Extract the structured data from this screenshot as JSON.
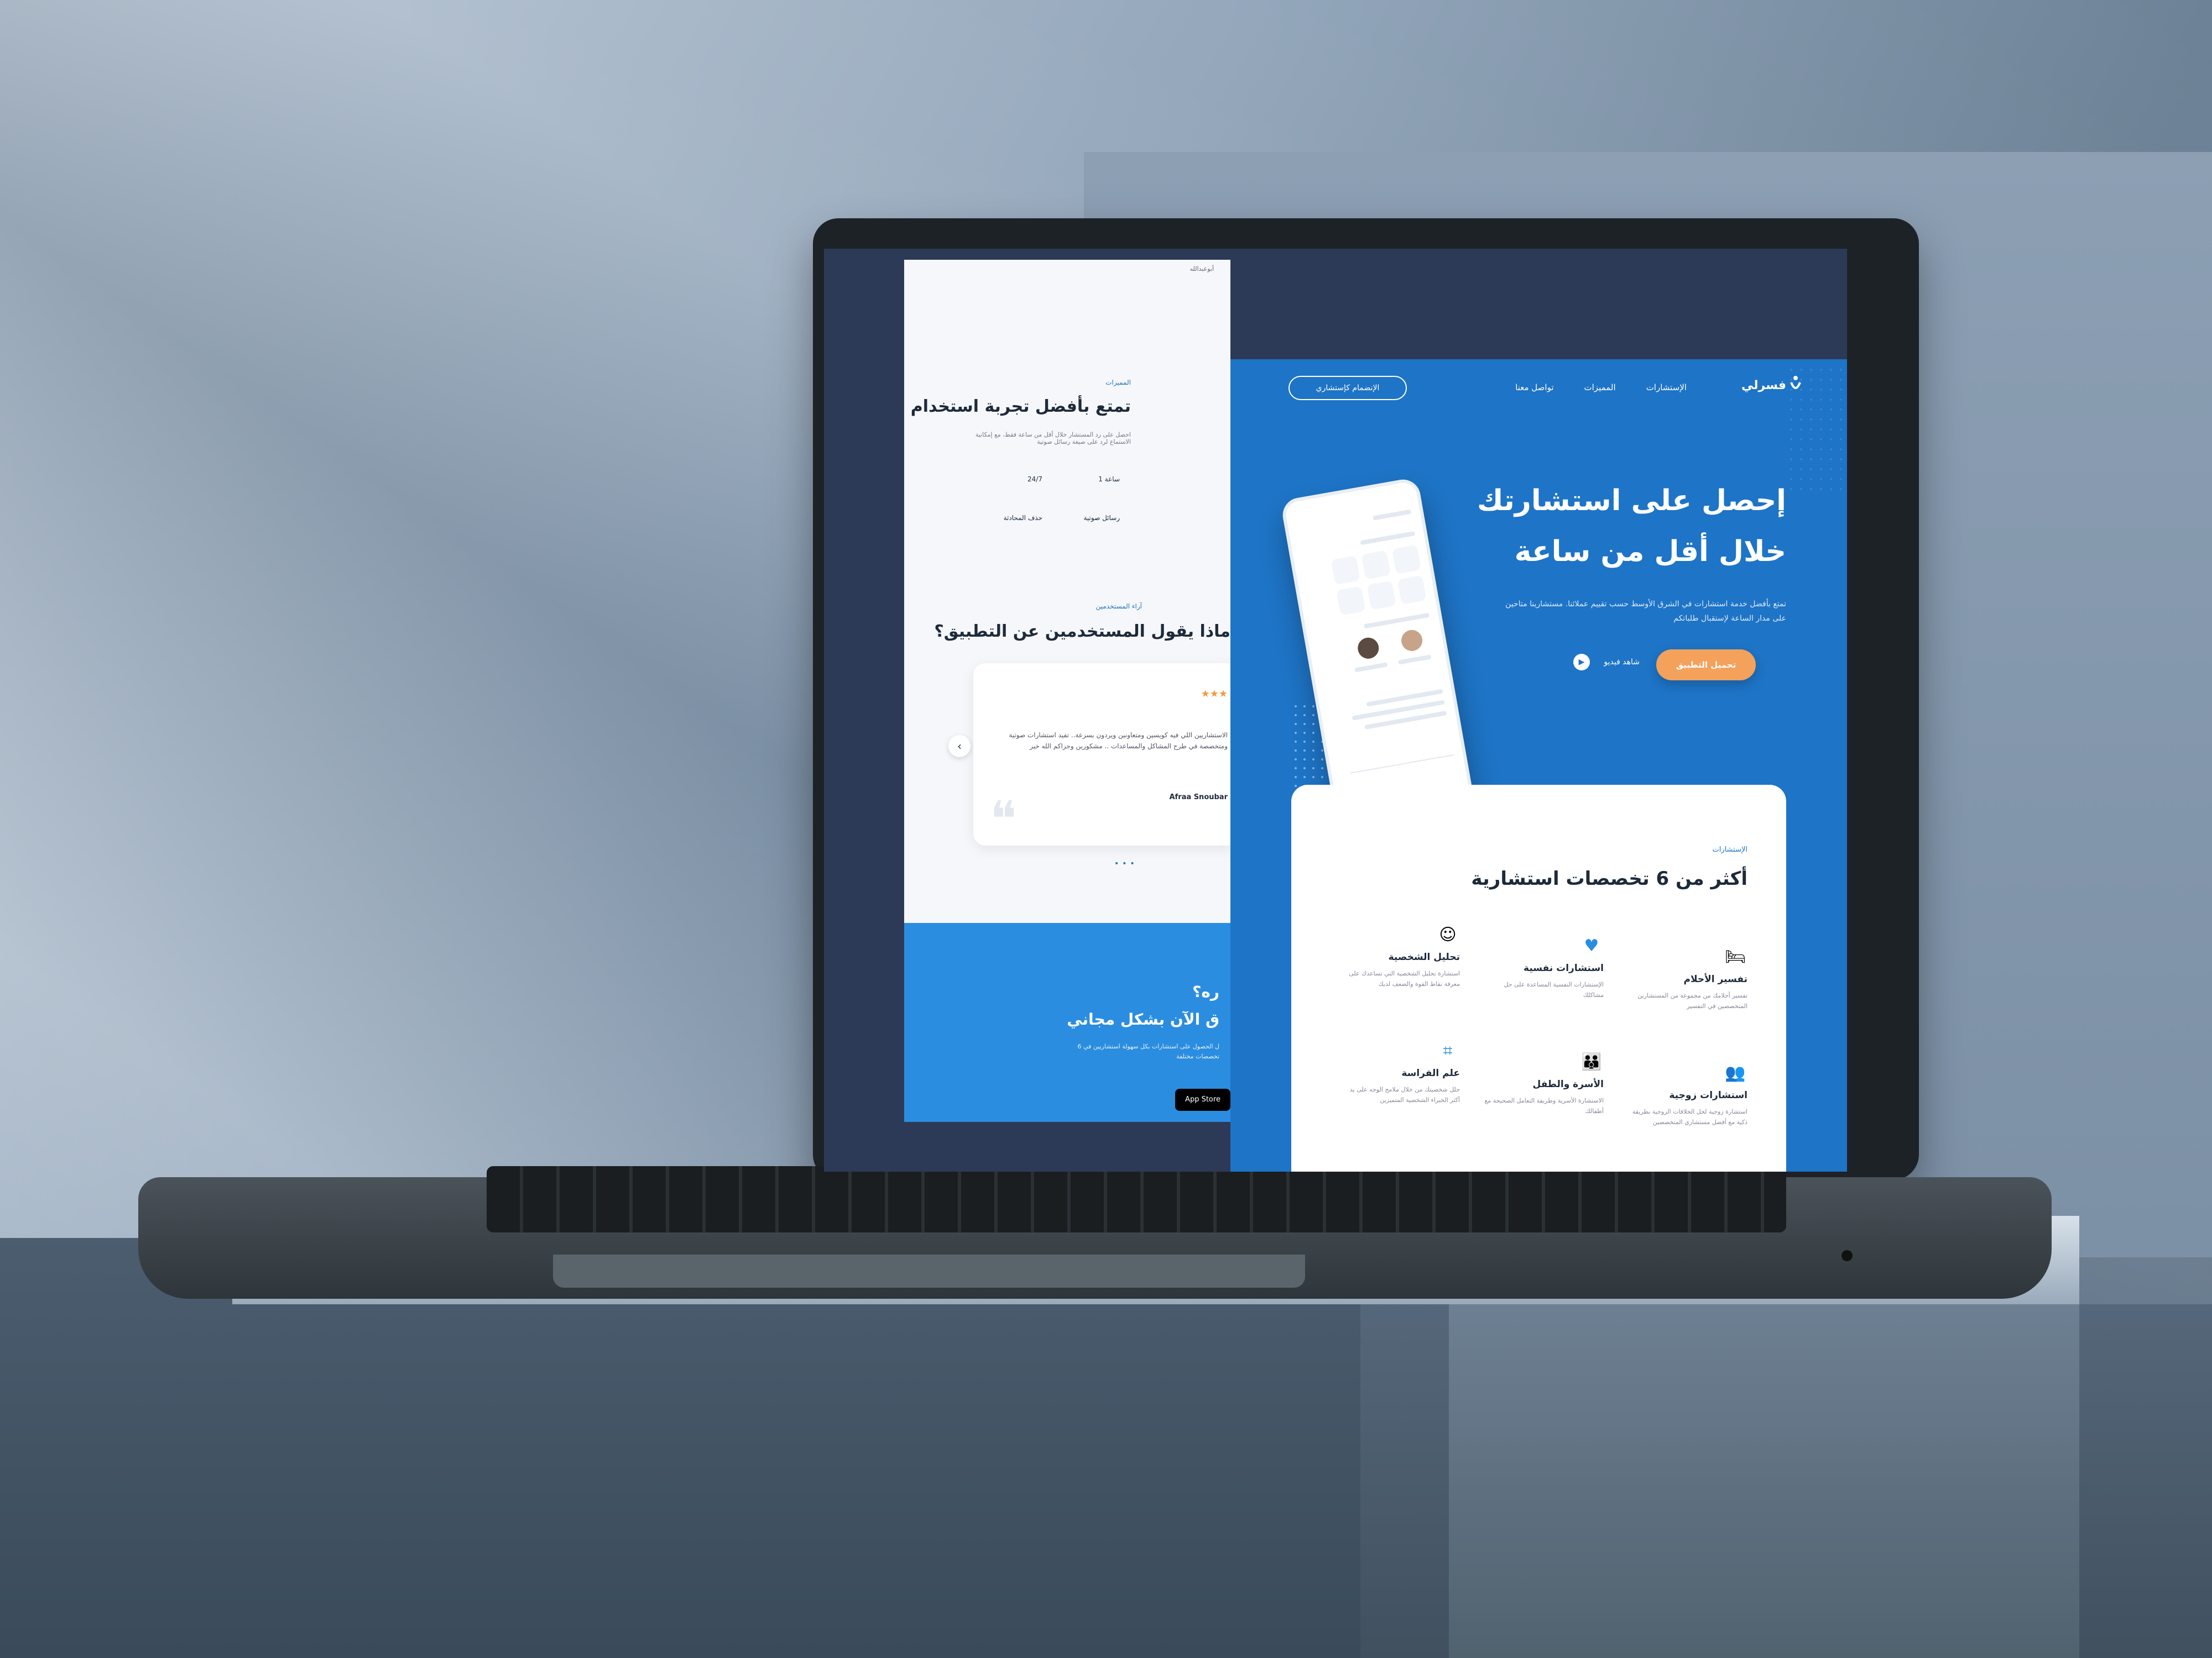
{
  "hero": {
    "logo": "فسرلي",
    "nav": [
      "الإستشارات",
      "المميزات",
      "تواصل معنا"
    ],
    "join_button": "الإنضمام كإستشاري",
    "headline_line1": "إحصل على استشارتك",
    "headline_line2": "خلال أقل من ساعة",
    "description": "تمتع بأفضل خدمة استشارات في الشرق الأوسط حسب تقييم عملائنا. مستشارينا متاحين على مدار الساعة لإستقبال طلباتكم",
    "download_button": "تحميل التطبيق",
    "watch_video": "شاهد فيديو"
  },
  "consultations": {
    "tag": "الإستشارات",
    "title": "أكثر من 6 تخصصات استشارية",
    "services": [
      {
        "title": "تفسير الأحلام",
        "desc": "تفسير أحلامك من مجموعة من المستشارين المتخصصين في التفسير",
        "icon": "dream-icon"
      },
      {
        "title": "استشارات نفسية",
        "desc": "الإستشارات النفسية المساعدة على حل مشاكلك",
        "icon": "heart-icon"
      },
      {
        "title": "تحليل الشخصية",
        "desc": "استشارة تحليل الشخصية التي تساعدك على معرفة نقاط القوة والضعف لديك",
        "icon": "person-icon"
      },
      {
        "title": "استشارات زوجية",
        "desc": "استشارة زوجية لحل الخلافات الزوجية بطريقة ذكية مع أفضل مستشاري المتخصصين",
        "icon": "couple-icon"
      },
      {
        "title": "الأسرة والطفل",
        "desc": "الاستشارة الأسرية وطريقة التعامل الصحيحة مع أطفالك",
        "icon": "family-icon"
      },
      {
        "title": "علم الفراسة",
        "desc": "حلل شخصيتك من خلال ملامح الوجه على يد أكثر الخبراء الشخصية المتميزين",
        "icon": "face-scan-icon"
      }
    ]
  },
  "left_page": {
    "top_text": "أبوعبدالله",
    "features_tag": "المميزات",
    "features_title": "تمتع بأفضل تجربة استخدام",
    "features_desc": "احصل على رد المستشار خلال أقل من ساعة فقط، مع إمكانية الاستماع لرد على صيغة رسائل صوتية",
    "stats": [
      "1 ساعة",
      "24/7",
      "رسائل صوتية",
      "حذف المحادثة"
    ],
    "users_tag": "آراء المستخدمين",
    "users_title": "ماذا يقول المستخدمين عن التطبيق؟",
    "review_text": "الاستشاريين اللي فيه كويسين ومتعاونين ويردون بسرعة.. تفيد استشارات صوتية ومتخصصة في طرح المشاكل والمساعدات .. مشكورين وجزاكم الله خير",
    "review_name": "Afraa Snoubar",
    "stars": "★★★",
    "cta_title_line1": "ره؟",
    "cta_title_line2": "ق الآن بشكل مجاني",
    "cta_desc": "ل الحصول على استشارات بكل سهولة استشاريين في 6 تخصصات مختلفة",
    "appstore": "App Store"
  }
}
